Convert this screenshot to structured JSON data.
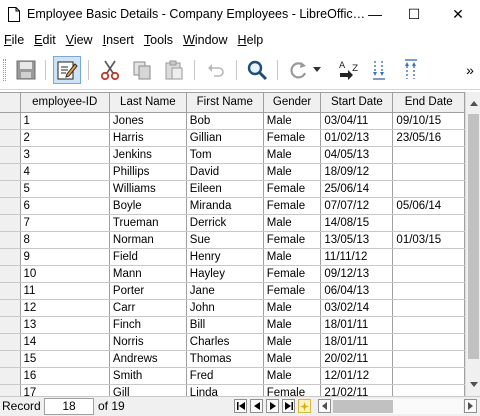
{
  "window": {
    "title": "Employee Basic Details - Company Employees - LibreOffic…",
    "controls": [
      "—",
      "☐",
      "✕"
    ]
  },
  "menu": [
    {
      "accel": "F",
      "rest": "ile"
    },
    {
      "accel": "E",
      "rest": "dit"
    },
    {
      "accel": "V",
      "rest": "iew"
    },
    {
      "accel": "I",
      "rest": "nsert"
    },
    {
      "accel": "T",
      "rest": "ools"
    },
    {
      "accel": "W",
      "rest": "indow"
    },
    {
      "accel": "H",
      "rest": "elp"
    }
  ],
  "toolbar": {
    "more": "»",
    "icons": [
      "save-icon",
      "edit-mode-icon",
      "cut-icon",
      "copy-icon",
      "paste-icon",
      "undo-icon",
      "find-icon",
      "refresh-icon",
      "sort-icon",
      "sort-ascending-icon",
      "sort-descending-icon"
    ]
  },
  "grid": {
    "columns": [
      "employee-ID",
      "Last Name",
      "First Name",
      "Gender",
      "Start Date",
      "End Date"
    ],
    "rows": [
      [
        "1",
        "Jones",
        "Bob",
        "Male",
        "03/04/11",
        "09/10/15"
      ],
      [
        "2",
        "Harris",
        "Gillian",
        "Female",
        "01/02/13",
        "23/05/16"
      ],
      [
        "3",
        "Jenkins",
        "Tom",
        "Male",
        "04/05/13",
        ""
      ],
      [
        "4",
        "Phillips",
        "David",
        "Male",
        "18/09/12",
        ""
      ],
      [
        "5",
        "Williams",
        "Eileen",
        "Female",
        "25/06/14",
        ""
      ],
      [
        "6",
        "Boyle",
        "Miranda",
        "Female",
        "07/07/12",
        "05/06/14"
      ],
      [
        "7",
        "Trueman",
        "Derrick",
        "Male",
        "14/08/15",
        ""
      ],
      [
        "8",
        "Norman",
        "Sue",
        "Female",
        "13/05/13",
        "01/03/15"
      ],
      [
        "9",
        "Field",
        "Henry",
        "Male",
        "11/11/12",
        ""
      ],
      [
        "10",
        "Mann",
        "Hayley",
        "Female",
        "09/12/13",
        ""
      ],
      [
        "11",
        "Porter",
        "Jane",
        "Female",
        "06/04/13",
        ""
      ],
      [
        "12",
        "Carr",
        "John",
        "Male",
        "03/02/14",
        ""
      ],
      [
        "13",
        "Finch",
        "Bill",
        "Male",
        "18/01/11",
        ""
      ],
      [
        "14",
        "Norris",
        "Charles",
        "Male",
        "18/01/11",
        ""
      ],
      [
        "15",
        "Andrews",
        "Thomas",
        "Male",
        "20/02/11",
        ""
      ],
      [
        "16",
        "Smith",
        "Fred",
        "Male",
        "12/01/12",
        ""
      ],
      [
        "17",
        "Gill",
        "Linda",
        "Female",
        "21/02/11",
        ""
      ]
    ]
  },
  "record_bar": {
    "label": "Record",
    "current": "18",
    "of_label": "of 19"
  },
  "colors": {
    "active_tool_bg": "#cfe3f7",
    "header_bg": "#f0f0f0",
    "grid_line": "#a0a0a0"
  }
}
